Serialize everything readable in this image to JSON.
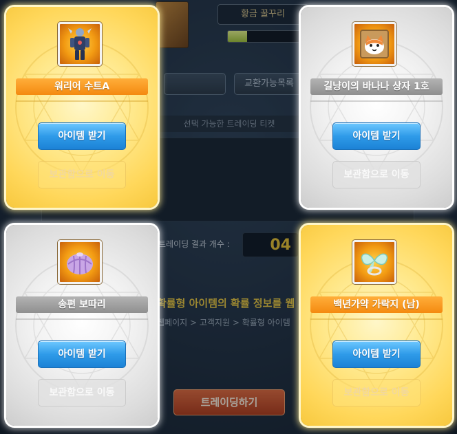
{
  "background": {
    "title": "황금 꿀꾸리",
    "progress": 0.25,
    "tabs": [
      {
        "label": "교환가능목록"
      },
      {
        "label": ""
      }
    ],
    "subheader": "선택 가능한 트레이딩 티켓",
    "result_label": "트레이딩 결과 개수 :",
    "result_value": "04",
    "notice": "확률형 아이템의 확률 정보를 웹 페이지에서",
    "path": "웹페이지 > 고객지원 > 확률형 아이템",
    "trade_button": "트레이딩하기"
  },
  "cards": [
    {
      "item_name": "워리어 수트A",
      "get_label": "아이템 받기",
      "move_label": "보관함으로 이동",
      "tier": "gold",
      "icon": "warrior-suit-icon"
    },
    {
      "item_name": "길냥이의 바나나 상자 1호",
      "get_label": "아이템 받기",
      "move_label": "보관함으로 이동",
      "tier": "silver",
      "icon": "cat-box-icon"
    },
    {
      "item_name": "송편 보따리",
      "get_label": "아이템 받기",
      "move_label": "보관함으로 이동",
      "tier": "silver",
      "icon": "songpyeon-bundle-icon"
    },
    {
      "item_name": "백년가약 가락지 (남)",
      "get_label": "아이템 받기",
      "move_label": "보관함으로 이동",
      "tier": "gold",
      "icon": "wedding-ring-icon"
    }
  ],
  "colors": {
    "gold_card": "#ffe98e",
    "silver_card": "#f1f1f1",
    "name_orange": "#f48a10",
    "name_gray": "#8f8f8f",
    "button_blue": "#2f9be9"
  }
}
